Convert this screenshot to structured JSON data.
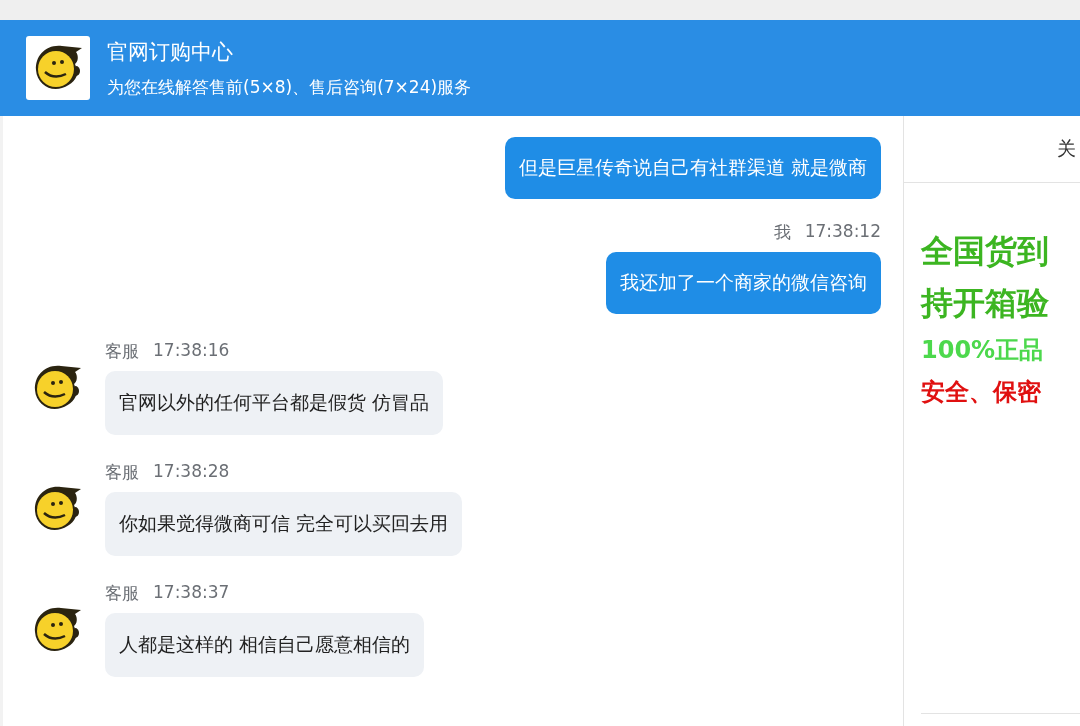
{
  "header": {
    "title": "官网订购中心",
    "subtitle": "为您在线解答售前(5×8)、售后咨询(7×24)服务"
  },
  "messages": [
    {
      "kind": "me",
      "text": "但是巨星传奇说自己有社群渠道 就是微商"
    },
    {
      "kind": "me",
      "sender": "我",
      "time": "17:38:12",
      "text": "我还加了一个商家的微信咨询"
    },
    {
      "kind": "agent",
      "sender": "客服",
      "time": "17:38:16",
      "text": "官网以外的任何平台都是假货 仿冒品"
    },
    {
      "kind": "agent",
      "sender": "客服",
      "time": "17:38:28",
      "text": "你如果觉得微商可信 完全可以买回去用"
    },
    {
      "kind": "agent",
      "sender": "客服",
      "time": "17:38:37",
      "text": "人都是这样的 相信自己愿意相信的"
    }
  ],
  "side_panel": {
    "tab": "关",
    "lines": [
      {
        "kind": "headline",
        "text": "全国货到"
      },
      {
        "kind": "headline",
        "text": "持开箱验"
      },
      {
        "kind": "promo",
        "text": "100%正品"
      },
      {
        "kind": "warning",
        "text": "安全、保密"
      }
    ]
  }
}
